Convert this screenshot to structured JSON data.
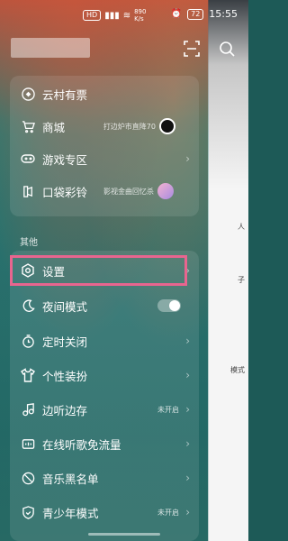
{
  "status": {
    "carrier": "HD",
    "speed": "890\nK/s",
    "battery": "72",
    "time": "15:55"
  },
  "menu_top": [
    {
      "label": "云村有票",
      "icon": "ticket-icon"
    },
    {
      "label": "商城",
      "icon": "cart-icon",
      "value": "打边炉市直降70"
    },
    {
      "label": "游戏专区",
      "icon": "gamepad-icon"
    },
    {
      "label": "口袋彩铃",
      "icon": "ringtone-icon",
      "value": "影视金曲回忆杀"
    }
  ],
  "section": {
    "title": "其他"
  },
  "menu_other": [
    {
      "label": "设置",
      "icon": "gear-icon"
    },
    {
      "label": "夜间模式",
      "icon": "moon-icon"
    },
    {
      "label": "定时关闭",
      "icon": "timer-icon"
    },
    {
      "label": "个性装扮",
      "icon": "shirt-icon"
    },
    {
      "label": "边听边存",
      "icon": "music-save-icon",
      "value": "未开启"
    },
    {
      "label": "在线听歌免流量",
      "icon": "data-free-icon"
    },
    {
      "label": "音乐黑名单",
      "icon": "block-icon"
    },
    {
      "label": "青少年模式",
      "icon": "shield-icon",
      "value": "未开启"
    }
  ],
  "right_peek": [
    "人",
    "子",
    "模式"
  ],
  "colors": {
    "highlight": "#e8658f"
  }
}
